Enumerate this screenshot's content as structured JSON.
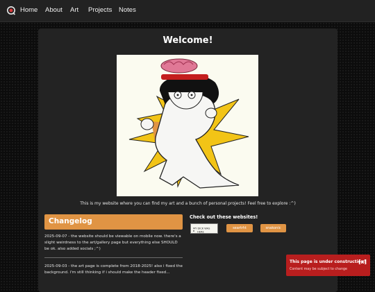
{
  "nav": {
    "logo_icon": "headphones-logo-icon",
    "items": [
      {
        "label": "Home"
      },
      {
        "label": "About"
      },
      {
        "label": "Art"
      },
      {
        "label": "Projects"
      },
      {
        "label": "Notes"
      }
    ]
  },
  "main": {
    "title": "Welcome!",
    "artwork_icon": "character-illustration",
    "intro": "This is my website where you can find my art and a bunch of personal projects! Feel free to explore :^)",
    "changelog": {
      "heading": "Changelog",
      "entries": [
        "2025-09-07 - the website should be viewable on mobile now. there's a slight weirdness to the art/gallery page but everything else SHOULD be ok. also added socials ;^)",
        "2025-09-03 - the art page is complete from 2018-2025! also i fixed the background. i'm still thinking if i should make the header fixed..."
      ]
    },
    "websites": {
      "heading": "Check out these websites!",
      "badge_text": "MY DICK WAS HERE",
      "links": [
        {
          "label": "seartrht"
        },
        {
          "label": "snakonic"
        }
      ]
    }
  },
  "toast": {
    "title": "This page is under construction!",
    "subtitle": "Content may be subject to change",
    "close_label": "[x]"
  },
  "colors": {
    "accent": "#e09444",
    "toast": "#b81e1e",
    "panel": "#232323",
    "nav": "#222222"
  }
}
